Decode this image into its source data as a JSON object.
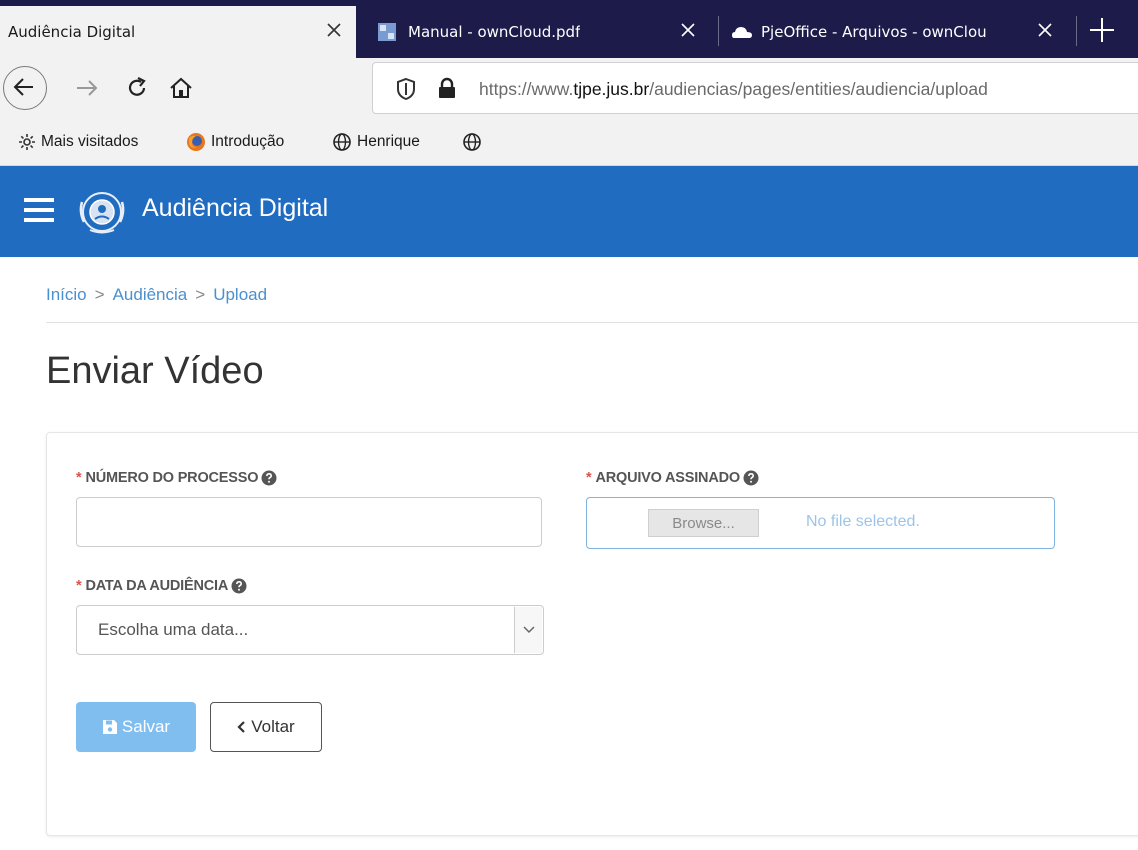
{
  "browser": {
    "tabs": [
      {
        "title": "Audiência Digital",
        "active": true
      },
      {
        "title": "Manual - ownCloud.pdf",
        "active": false
      },
      {
        "title": "PjeOffice - Arquivos - ownClou",
        "active": false
      }
    ],
    "url": {
      "prefix": "https://www.",
      "host": "tjpe.jus.br",
      "path": "/audiencias/pages/entities/audiencia/upload"
    },
    "bookmarks": [
      {
        "label": "Mais visitados",
        "icon": "gear-icon"
      },
      {
        "label": "Introdução",
        "icon": "firefox-icon"
      },
      {
        "label": "Henrique",
        "icon": "globe-icon"
      },
      {
        "label": "",
        "icon": "globe-icon"
      }
    ]
  },
  "app": {
    "title": "Audiência Digital",
    "header_color": "#1f6cc1"
  },
  "breadcrumb": {
    "items": [
      "Início",
      "Audiência",
      "Upload"
    ],
    "separator": ">"
  },
  "page": {
    "title": "Enviar Vídeo"
  },
  "form": {
    "required_mark": "*",
    "processo": {
      "label": "NÚMERO DO PROCESSO",
      "value": ""
    },
    "arquivo": {
      "label": "ARQUIVO ASSINADO",
      "browse_label": "Browse...",
      "status": "No file selected."
    },
    "data": {
      "label": "DATA DA AUDIÊNCIA",
      "placeholder": "Escolha uma data..."
    },
    "buttons": {
      "save": "Salvar",
      "back": "Voltar"
    }
  }
}
